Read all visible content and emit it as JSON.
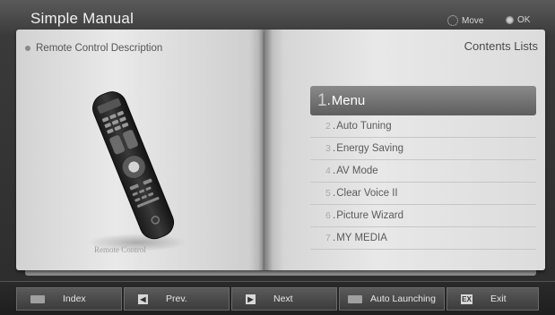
{
  "header": {
    "title": "Simple Manual",
    "hint_move": "Move",
    "hint_ok": "OK"
  },
  "left_page": {
    "section_title": "Remote Control Description",
    "image_caption": "Remote Control"
  },
  "right_page": {
    "title": "Contents Lists",
    "items": [
      {
        "num": "1",
        "label": "Menu",
        "selected": true
      },
      {
        "num": "2",
        "label": "Auto Tuning"
      },
      {
        "num": "3",
        "label": "Energy Saving"
      },
      {
        "num": "4",
        "label": "AV Mode"
      },
      {
        "num": "5",
        "label": "Clear Voice II"
      },
      {
        "num": "6",
        "label": "Picture Wizard"
      },
      {
        "num": "7",
        "label": "MY MEDIA"
      }
    ]
  },
  "footer": {
    "buttons": [
      {
        "label": "Index",
        "icon": "index-key"
      },
      {
        "label": "Prev.",
        "icon": "prev-key"
      },
      {
        "label": "Next",
        "icon": "next-key"
      },
      {
        "label": "Auto Launching",
        "icon": "auto-launch-key"
      },
      {
        "label": "Exit",
        "icon": "exit-key"
      }
    ]
  }
}
